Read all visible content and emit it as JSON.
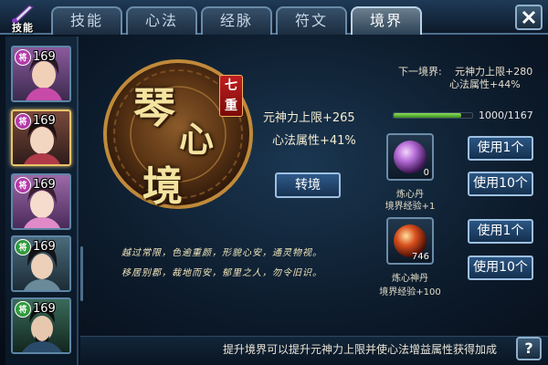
{
  "badge": {
    "label": "技能"
  },
  "tabs": [
    {
      "label": "技能"
    },
    {
      "label": "心法"
    },
    {
      "label": "经脉"
    },
    {
      "label": "符文"
    },
    {
      "label": "境界"
    }
  ],
  "active_tab": "境界",
  "heroes": [
    {
      "tag": "将",
      "level": "169",
      "tag_color": "#b23aa8"
    },
    {
      "tag": "将",
      "level": "169",
      "tag_color": "#b23aa8"
    },
    {
      "tag": "将",
      "level": "169",
      "tag_color": "#b23aa8"
    },
    {
      "tag": "将",
      "level": "169",
      "tag_color": "#2f9a3c"
    },
    {
      "tag": "将",
      "level": "169",
      "tag_color": "#2f9a3c"
    }
  ],
  "realm": {
    "chars": [
      "琴",
      "心",
      "境"
    ],
    "rank_chars": [
      "七",
      "重"
    ],
    "stat_1": "元神力上限+265",
    "stat_2": "心法属性+41%",
    "transform_label": "转境",
    "poem_line_1": "越过常限，色逾重颜，形貌心安，通灵物视。",
    "poem_line_2": "移居别郡，裁地而安，郁里之人，勿令旧识。"
  },
  "next": {
    "label": "下一境界:",
    "stat_1": "元神力上限+280",
    "stat_2": "心法属性+44%"
  },
  "progress": {
    "text": "1000/1167",
    "value": 1000,
    "max": 1167
  },
  "items": [
    {
      "count": "0",
      "name": "炼心丹",
      "effect": "境界经验+1",
      "button_1": "使用1个",
      "button_10": "使用10个",
      "color": "#b36ad4"
    },
    {
      "count": "746",
      "name": "炼心神丹",
      "effect": "境界经验+100",
      "button_1": "使用1个",
      "button_10": "使用10个",
      "color": "#d8501e"
    }
  ],
  "hint": "提升境界可以提升元神力上限并使心法增益属性获得加成",
  "help_label": "?"
}
